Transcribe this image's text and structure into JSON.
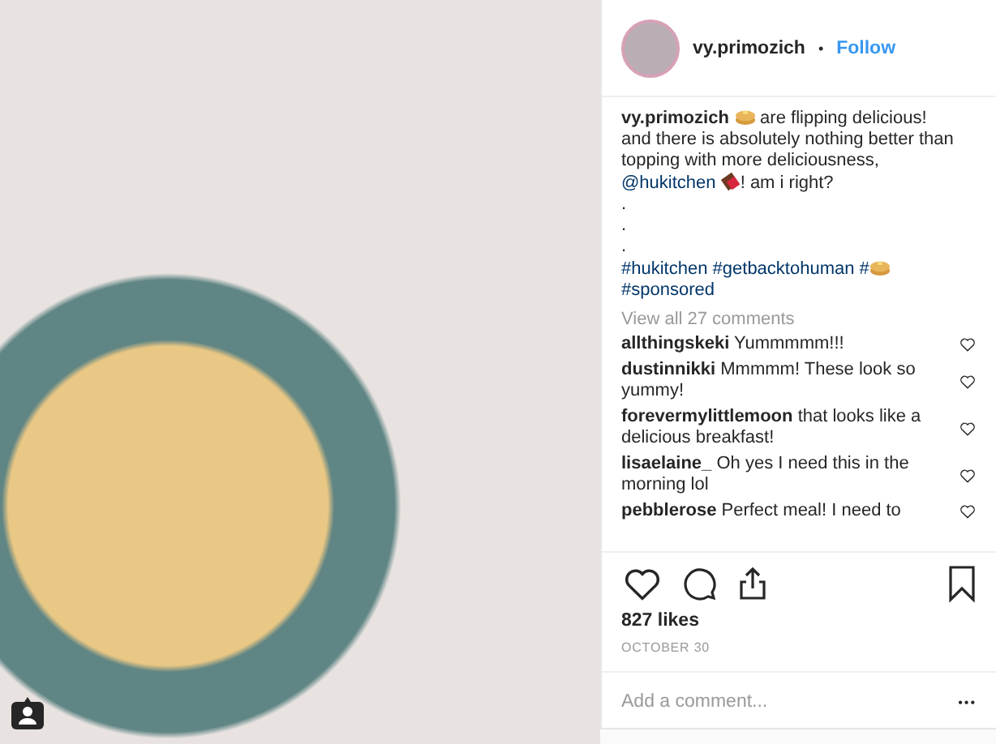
{
  "post": {
    "header": {
      "username": "vy.primozich",
      "separator": "•",
      "follow": "Follow"
    },
    "caption": [
      {
        "kind": "user",
        "text": "vy.primozich"
      },
      {
        "kind": "emoji_pancake"
      },
      {
        "kind": "text",
        "text": " are flipping delicious! and there is absolutely nothing better than topping with more deliciousness, "
      },
      {
        "kind": "mention",
        "text": "@hukitchen"
      },
      {
        "kind": "emoji_chocolate"
      },
      {
        "kind": "text",
        "text": "! am i right?"
      },
      {
        "kind": "break"
      },
      {
        "kind": "text",
        "text": "."
      },
      {
        "kind": "break"
      },
      {
        "kind": "text",
        "text": "."
      },
      {
        "kind": "break"
      },
      {
        "kind": "text",
        "text": "."
      },
      {
        "kind": "break"
      },
      {
        "kind": "hashtag",
        "text": "#hukitchen"
      },
      {
        "kind": "space"
      },
      {
        "kind": "hashtag",
        "text": "#getbacktohuman"
      },
      {
        "kind": "space"
      },
      {
        "kind": "hashtag",
        "text": "#"
      },
      {
        "kind": "emoji_pancake"
      },
      {
        "kind": "break"
      },
      {
        "kind": "hashtag",
        "text": "#sponsored"
      }
    ],
    "view_all": "View all 27 comments",
    "comments": [
      {
        "user": "allthingskeki",
        "text": "Yummmmm!!!"
      },
      {
        "user": "dustinnikki",
        "text": "Mmmmm! These look so yummy!"
      },
      {
        "user": "forevermylittlemoon",
        "text": "that looks like a delicious breakfast!"
      },
      {
        "user": "lisaelaine_",
        "text": "Oh yes I need this in the morning lol"
      },
      {
        "user": "pebblerose",
        "text": "Perfect meal! I need to"
      }
    ],
    "likes": "827 likes",
    "date": "OCTOBER 30",
    "add_comment": {
      "placeholder": "Add a comment..."
    },
    "more": "•••"
  }
}
